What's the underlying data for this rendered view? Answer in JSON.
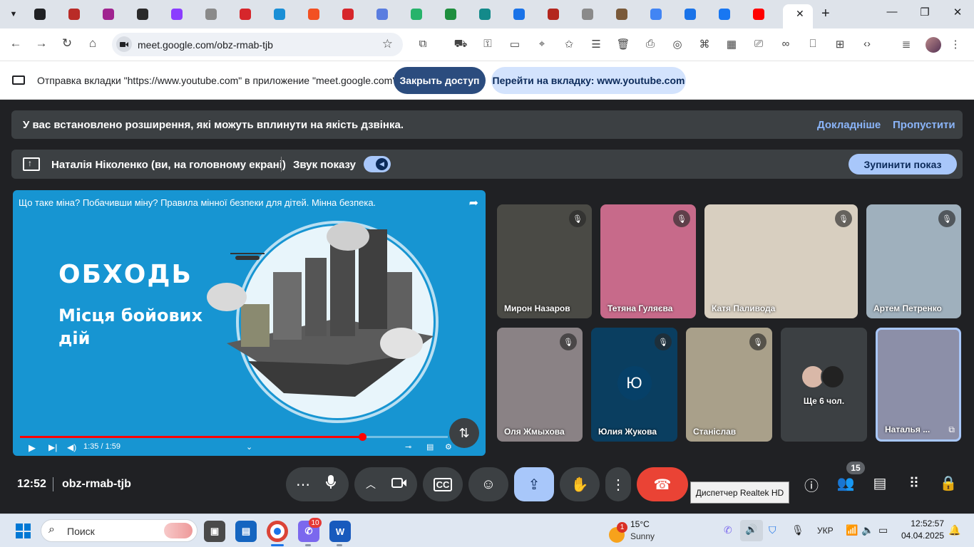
{
  "browser": {
    "tabs": [
      {
        "icon": "dark-app",
        "color": "#202124"
      },
      {
        "icon": "quora",
        "color": "#b92b27"
      },
      {
        "icon": "quora",
        "color": "#a02490"
      },
      {
        "icon": "adobe",
        "color": "#2a2a2a"
      },
      {
        "icon": "cube",
        "color": "#8b3dff"
      },
      {
        "icon": "globe",
        "color": "#8a8a8a"
      },
      {
        "icon": "red-ball",
        "color": "#d6262b"
      },
      {
        "icon": "puzzle",
        "color": "#1a8fd6"
      },
      {
        "icon": "microsoft",
        "color": "#f25022"
      },
      {
        "icon": "red-ball",
        "color": "#d6262b"
      },
      {
        "icon": "colorful",
        "color": "#5a7de0"
      },
      {
        "icon": "d-logo",
        "color": "#27b36b"
      },
      {
        "icon": "classroom",
        "color": "#1e8e3e"
      },
      {
        "icon": "classroom",
        "color": "#138a8a"
      },
      {
        "icon": "g-logo",
        "color": "#1a73e8"
      },
      {
        "icon": "fi-logo",
        "color": "#b3261e"
      },
      {
        "icon": "globe",
        "color": "#8a8a8a"
      },
      {
        "icon": "image",
        "color": "#7a5a3a"
      },
      {
        "icon": "google",
        "color": "#4285f4"
      },
      {
        "icon": "meet",
        "color": "#1a73e8"
      },
      {
        "icon": "facebook",
        "color": "#1877f2"
      },
      {
        "icon": "youtube",
        "color": "#ff0000"
      }
    ],
    "url": "meet.google.com/obz-rmab-tjb"
  },
  "infobar": {
    "message": "Отправка вкладки \"https://www.youtube.com\" в приложение \"meet.google.com\"...",
    "stop_label": "Закрыть доступ",
    "goto_label": "Перейти на вкладку: www.youtube.com"
  },
  "extension_warning": {
    "text": "У вас встановлено розширення, які можуть вплинути на якість дзвінка.",
    "more_label": "Докладніше",
    "skip_label": "Пропустити"
  },
  "presentation_bar": {
    "presenter": "Наталія Ніколенко (ви, на головному екрані)",
    "sound_label": "Звук показу",
    "stop_label": "Зупинити показ"
  },
  "video": {
    "title": "Що таке міна? Побачивши міну? Правила мінної безпеки для дітей. Мінна безпека.",
    "headline": "ОБХОДЬ",
    "subline": "Місця бойових дій",
    "time": "1:35 / 1:59",
    "progress": 0.8
  },
  "participants": [
    {
      "name": "Мирон Назаров",
      "muted": true,
      "bg": "#4a4a45"
    },
    {
      "name": "Тетяна Гуляєва",
      "muted": true,
      "bg": "#c76a8a"
    },
    {
      "name": "Катя Паливода",
      "muted": true,
      "bg": "#d8cfc0"
    },
    {
      "name": "Артем Петренко",
      "muted": true,
      "bg": "#9fb0bd"
    },
    {
      "name": "Оля Жмыхова",
      "muted": true,
      "bg": "#8a8285"
    },
    {
      "name": "Юлия Жукова",
      "muted": true,
      "bg": "#0a3e60",
      "avatar": "Ю"
    },
    {
      "name": "Станіслав",
      "muted": true,
      "bg": "#a9a08a"
    },
    {
      "name": "Ще 6 чол.",
      "muted": false,
      "bg": "#3c4043"
    },
    {
      "name": "Наталья ...",
      "muted": false,
      "bg": "#8c8fa8"
    }
  ],
  "meeting": {
    "time": "12:52",
    "code": "obz-rmab-tjb",
    "people_count": "15",
    "tooltip": "Диспетчер Realtek HD"
  },
  "taskbar": {
    "search_placeholder": "Поиск",
    "mail_badge": "10",
    "weather_badge": "1",
    "temperature": "15°C",
    "weather": "Sunny",
    "lang": "УКР",
    "time": "12:52:57",
    "date": "04.04.2025"
  }
}
